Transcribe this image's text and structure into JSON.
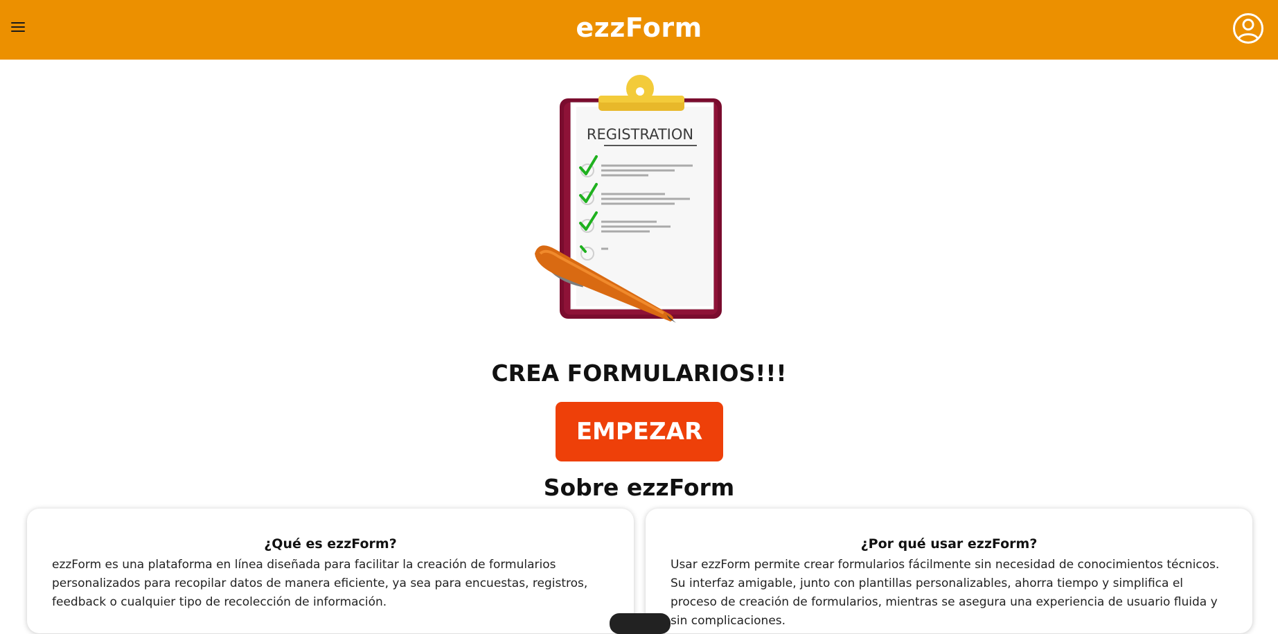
{
  "header": {
    "brand": "ezzForm",
    "menu_icon": "hamburger-menu-icon",
    "user_icon": "user-account-icon",
    "background": "#ec9000"
  },
  "hero": {
    "illustration": {
      "icon": "clipboard-registration-illustration",
      "heading": "REGISTRATION"
    },
    "title": "CREA FORMULARIOS!!!",
    "cta_label": "EMPEZAR",
    "cta_color": "#ee4009"
  },
  "about": {
    "title": "Sobre ezzForm",
    "cards": [
      {
        "title": "¿Qué es ezzForm?",
        "text": "ezzForm es una plataforma en línea diseñada para facilitar la creación de formularios personalizados para recopilar datos de manera eficiente, ya sea para encuestas, registros, feedback o cualquier tipo de recolección de información."
      },
      {
        "title": "¿Por qué usar ezzForm?",
        "text": "Usar ezzForm permite crear formularios fácilmente sin necesidad de conocimientos técnicos. Su interfaz amigable, junto con plantillas personalizables, ahorra tiempo y simplifica el proceso de creación de formularios, mientras se asegura una experiencia de usuario fluida y sin complicaciones."
      }
    ]
  }
}
